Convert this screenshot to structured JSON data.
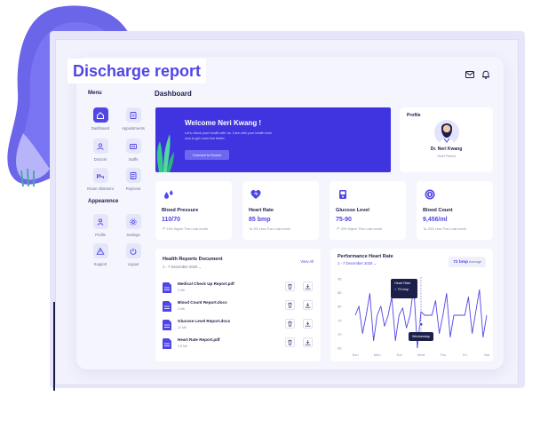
{
  "page_title": "Discharge report",
  "header": {
    "mail_icon": "mail-icon",
    "bell_icon": "bell-icon"
  },
  "sidebar": {
    "menu_heading": "Menu",
    "menu_items": [
      {
        "label": "Dashboard",
        "icon": "home-icon",
        "active": true
      },
      {
        "label": "Appointments",
        "icon": "calendar-icon",
        "active": false
      },
      {
        "label": "Doctors",
        "icon": "doctor-icon",
        "active": false
      },
      {
        "label": "Staffs",
        "icon": "staff-icon",
        "active": false
      },
      {
        "label": "Room Allotment",
        "icon": "bed-icon",
        "active": false
      },
      {
        "label": "Payment",
        "icon": "payment-icon",
        "active": false
      }
    ],
    "appearance_heading": "Appearence",
    "appearance_items": [
      {
        "label": "Profile",
        "icon": "user-icon"
      },
      {
        "label": "Settings",
        "icon": "gear-icon"
      },
      {
        "label": "Support",
        "icon": "warning-icon"
      },
      {
        "label": "Logout",
        "icon": "power-icon"
      }
    ]
  },
  "dashboard_title": "Dashboard",
  "banner": {
    "title": "Welcome Neri Kwang !",
    "subtitle": "Let's check your health with us. Care with your health from now to get more live better.",
    "button": "Connect to Doctor"
  },
  "profile": {
    "heading": "Profile",
    "name": "Dr. Neri Kwang",
    "role": "Heart Patient"
  },
  "stats": [
    {
      "name": "Blood Pressure",
      "value": "110/70",
      "change": "10% Higher Then Last month",
      "trend": "up",
      "icon": "droplets-icon"
    },
    {
      "name": "Heart Rate",
      "value": "85 bmp",
      "change": "5% Less Then Last month",
      "trend": "down",
      "icon": "heart-icon"
    },
    {
      "name": "Glucose Level",
      "value": "75-90",
      "change": "30% Higher Then Last month",
      "trend": "up",
      "icon": "glucose-icon"
    },
    {
      "name": "Blood Count",
      "value": "9,456/ml",
      "change": "25% Less Then Last month",
      "trend": "down",
      "icon": "blood-count-icon"
    }
  ],
  "reports": {
    "title": "Health Reports Document",
    "date": "1 - 7 December 2020",
    "view_all": "View All",
    "documents": [
      {
        "name": "Medical Check Up Report.pdf",
        "size": "2 Mb"
      },
      {
        "name": "Blood Count Report.docs",
        "size": "4 Mb"
      },
      {
        "name": "Glucose Level Report.docs",
        "size": "12 Mb"
      },
      {
        "name": "Heart Rate Report.pdf",
        "size": "3,5 Mb"
      }
    ]
  },
  "heart_rate": {
    "title": "Performance Heart Rate",
    "date": "1 - 7 December 2020",
    "average_value": "72 bmp",
    "average_label": "Average",
    "tooltip_title": "Heart Rate",
    "tooltip_value": "75 bmp",
    "tooltip_day": "Wednesday"
  },
  "chart_data": {
    "type": "line",
    "categories": [
      "Sun",
      "Mon",
      "Tue",
      "Wed",
      "Thu",
      "Fri",
      "Sat"
    ],
    "yticks": [
      95,
      85,
      80,
      75,
      70,
      65
    ],
    "highlight": {
      "category": "Wed",
      "value": 75
    },
    "series": [
      {
        "color": "#4f46e5",
        "values": [
          80,
          85,
          70,
          80,
          92,
          66,
          80,
          85,
          74,
          80,
          90,
          66,
          80,
          84,
          73,
          80,
          96,
          62,
          82,
          80,
          80,
          80,
          88,
          70,
          80,
          92,
          68,
          80,
          80,
          80,
          80,
          90,
          70,
          82,
          94,
          68,
          80
        ]
      }
    ]
  },
  "colors": {
    "accent": "#4f46e5",
    "banner": "#4034e0",
    "up": "#22c55e",
    "down": "#ef4444"
  }
}
